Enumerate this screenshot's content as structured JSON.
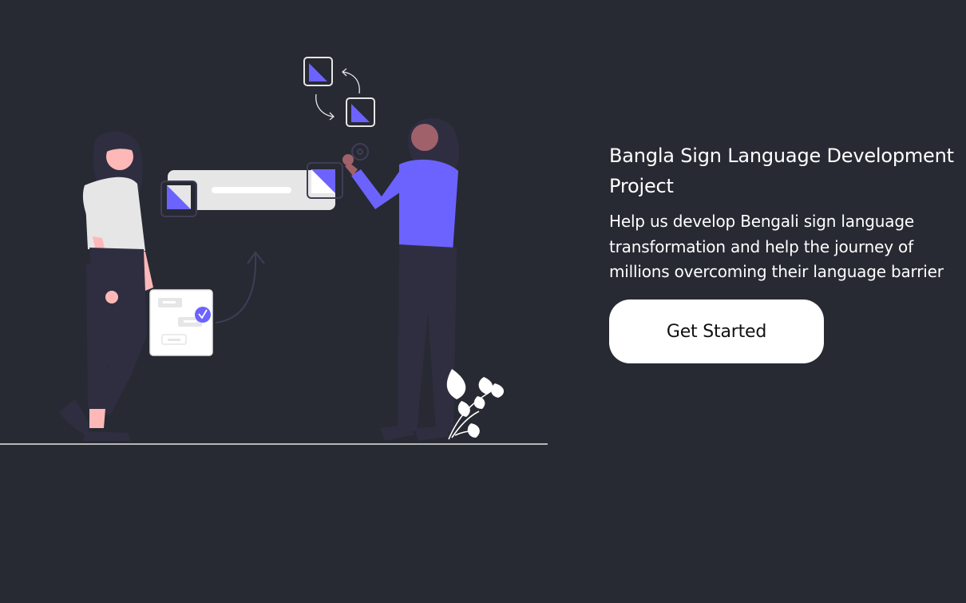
{
  "hero": {
    "title": "Bangla Sign Language Development Project",
    "subtitle": "Help us develop Bengali sign language transformation and help the journey of millions overcoming their language barrier",
    "cta_label": "Get Started"
  },
  "colors": {
    "background": "#272a33",
    "accent": "#6c63ff",
    "button_bg": "#ffffff",
    "text": "#ffffff"
  },
  "illustration": {
    "icons": [
      "person-woman-icon",
      "person-woman-purple-icon",
      "checklist-card-icon",
      "check-badge-icon",
      "swap-arrows-icon",
      "plant-icon"
    ]
  }
}
